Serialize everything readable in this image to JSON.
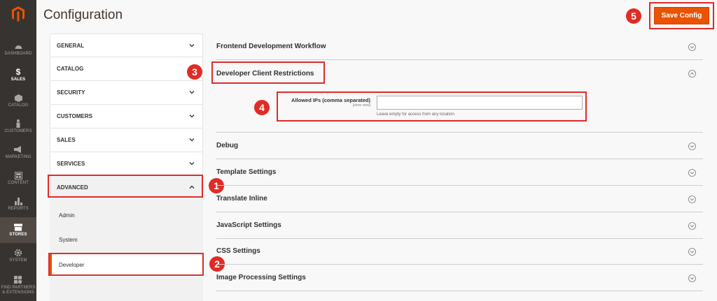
{
  "nav": {
    "items": [
      {
        "label": "DASHBOARD",
        "icon": "dashboard-icon"
      },
      {
        "label": "SALES",
        "icon": "dollar-icon"
      },
      {
        "label": "CATALOG",
        "icon": "cube-icon"
      },
      {
        "label": "CUSTOMERS",
        "icon": "person-icon"
      },
      {
        "label": "MARKETING",
        "icon": "megaphone-icon"
      },
      {
        "label": "CONTENT",
        "icon": "layout-icon"
      },
      {
        "label": "REPORTS",
        "icon": "bar-chart-icon"
      },
      {
        "label": "STORES",
        "icon": "store-icon"
      },
      {
        "label": "SYSTEM",
        "icon": "gear-icon"
      },
      {
        "label": "FIND PARTNERS & EXTENSIONS",
        "icon": "blocks-icon"
      }
    ]
  },
  "header": {
    "title": "Configuration",
    "save_label": "Save Config"
  },
  "colors": {
    "accent": "#eb5202",
    "highlight": "#e02b27",
    "nav_bg": "#373330"
  },
  "badges": [
    "1",
    "2",
    "3",
    "4",
    "5"
  ],
  "tabs": [
    {
      "label": "GENERAL"
    },
    {
      "label": "CATALOG"
    },
    {
      "label": "SECURITY"
    },
    {
      "label": "CUSTOMERS"
    },
    {
      "label": "SALES"
    },
    {
      "label": "SERVICES"
    },
    {
      "label": "ADVANCED"
    }
  ],
  "subtabs": [
    {
      "label": "Admin"
    },
    {
      "label": "System"
    },
    {
      "label": "Developer"
    }
  ],
  "sections": [
    {
      "title": "Frontend Development Workflow"
    },
    {
      "title": "Developer Client Restrictions"
    },
    {
      "title": "Debug"
    },
    {
      "title": "Template Settings"
    },
    {
      "title": "Translate Inline"
    },
    {
      "title": "JavaScript Settings"
    },
    {
      "title": "CSS Settings"
    },
    {
      "title": "Image Processing Settings"
    }
  ],
  "field": {
    "label": "Allowed IPs (comma separated)",
    "scope": "[store view]",
    "value": "",
    "note": "Leave empty for access from any location."
  }
}
